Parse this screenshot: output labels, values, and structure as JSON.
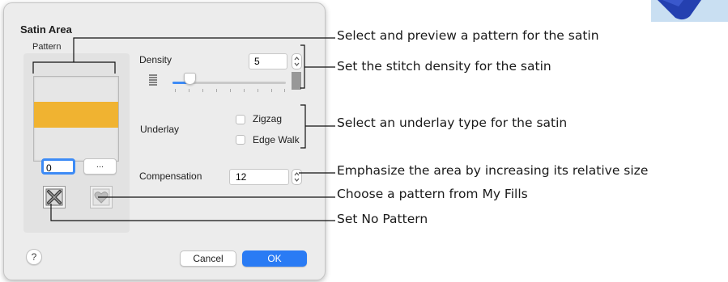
{
  "dialog": {
    "title": "Satin Area",
    "pattern": {
      "label": "Pattern",
      "number_value": "0",
      "browse_label": "...",
      "preview_color": "#f0b331"
    },
    "density": {
      "label": "Density",
      "value": "5",
      "slider_fraction": 0.1
    },
    "underlay": {
      "label": "Underlay",
      "options": [
        {
          "label": "Zigzag",
          "checked": false
        },
        {
          "label": "Edge Walk",
          "checked": false
        }
      ]
    },
    "compensation": {
      "label": "Compensation",
      "value": "12"
    },
    "buttons": {
      "help_label": "?",
      "cancel_label": "Cancel",
      "ok_label": "OK"
    }
  },
  "icons": {
    "no_pattern": "x-mark-icon",
    "my_fills": "heart-icon"
  },
  "callouts": [
    "Select and preview a pattern for the satin",
    "Set the stitch density for the satin",
    "Select an underlay type for the satin",
    "Emphasize the area by increasing its relative size",
    "Choose a pattern from My Fills",
    "Set No Pattern"
  ],
  "colors": {
    "accent": "#2a7bf4",
    "pattern_fill": "#f0b331",
    "fabric": "#2440b0"
  }
}
